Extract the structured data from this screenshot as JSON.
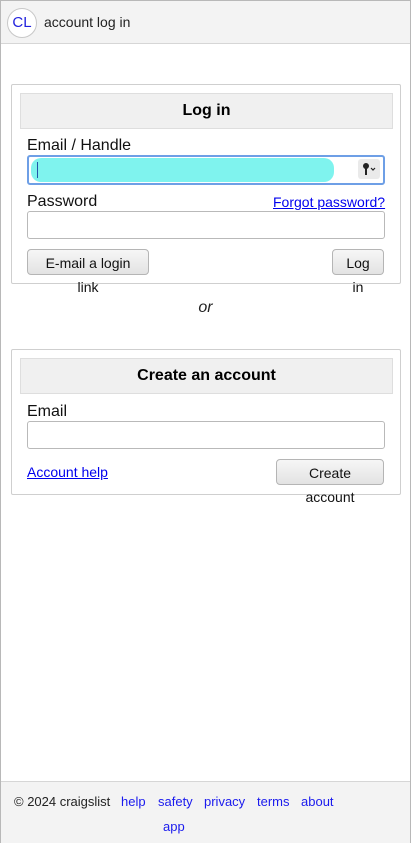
{
  "header": {
    "logo": "CL",
    "title": "account log in"
  },
  "login": {
    "heading": "Log in",
    "email_label": "Email / Handle",
    "email_value": "",
    "password_label": "Password",
    "forgot_link": "Forgot password?",
    "password_value": "",
    "email_link_button": "E-mail a login link",
    "login_button": "Log in"
  },
  "separator": "or",
  "create": {
    "heading": "Create an account",
    "email_label": "Email",
    "email_value": "",
    "help_link": "Account help",
    "create_button": "Create account"
  },
  "footer": {
    "copyright": "© 2024 craigslist",
    "links": [
      "help",
      "safety",
      "privacy",
      "terms",
      "about",
      "app"
    ]
  },
  "colors": {
    "link": "#0000ee",
    "focus_highlight": "#7ff3ee",
    "logo_text": "#2222dd"
  }
}
